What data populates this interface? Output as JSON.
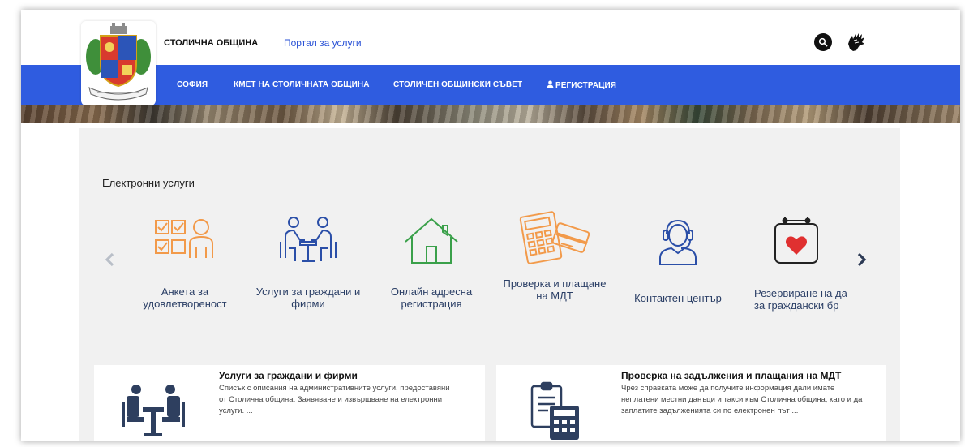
{
  "header": {
    "site_name": "СТОЛИЧНА ОБЩИНА",
    "portal_link": "Портал за услуги"
  },
  "nav": {
    "items": [
      {
        "label": "София"
      },
      {
        "label": "КМЕТ НА СТОЛИЧНАТА ОБЩИНА"
      },
      {
        "label": "СТОЛИЧЕН ОБЩИНСКИ СЪВЕТ"
      },
      {
        "label": "РЕГИСТРАЦИЯ",
        "icon": "user-icon"
      }
    ]
  },
  "services": {
    "title": "Електронни услуги",
    "items": [
      {
        "label": "Анкета за удовлетвореност",
        "icon": "survey-icon",
        "color": "#f29a4a"
      },
      {
        "label": "Услуги за граждани и фирми",
        "icon": "meeting-icon",
        "color": "#2b4fa8"
      },
      {
        "label": "Онлайн адресна регистрация",
        "icon": "house-icon",
        "color": "#3aa04a"
      },
      {
        "label": "Проверка и плащане на МДТ",
        "icon": "calculator-card-icon",
        "color": "#f29a4a"
      },
      {
        "label": "Контактен център",
        "icon": "operator-icon",
        "color": "#2b4fa8"
      },
      {
        "label": "Резервиране на да за граждански бр",
        "icon": "calendar-heart-icon",
        "color": "#e03030"
      }
    ]
  },
  "cards": [
    {
      "title": "Услуги за граждани и фирми",
      "description": "Списък с описания на административните услуги, предоставяни от Столична община. Заявяване и извършване на електронни услуги. ...",
      "icon": "meeting-icon"
    },
    {
      "title": "Проверка на задължения и плащания на МДТ",
      "description": "Чрез справката може да получите информация дали имате неплатени местни данъци и такси към Столична община, като и да заплатите задълженията си по електронен път ...",
      "icon": "calculator-icon"
    }
  ],
  "colors": {
    "nav_bg": "#2f5ce0",
    "link": "#2a52d6",
    "content_bg": "#f1f1f1"
  }
}
